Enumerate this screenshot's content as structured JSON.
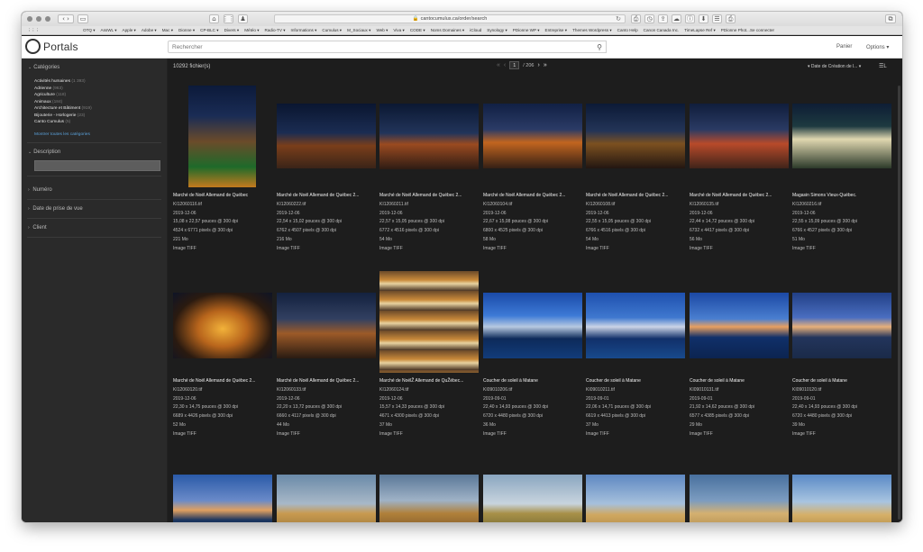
{
  "browser": {
    "url": "cantocumulus.ca/order/search",
    "bookmarks": [
      "OTQ ▾",
      "AssWL ▾",
      "Apple ▾",
      "Adobe ▾",
      "Mac ▾",
      "Dionne ▾",
      "CP-BLC ▾",
      "Divers ▾",
      "Météo ▾",
      "Radio-TV ▾",
      "Informations ▾",
      "Cumulus ▾",
      "M_Sociaux ▾",
      "Web ▾",
      "Viva ▾",
      "CODE ▾",
      "Noms Domaines ▾",
      "iCloud",
      "Synology ▾",
      "PDionne WP ▾",
      "Entreprise ▾",
      "Themes Wordpress ▾",
      "Canto Help",
      "Canon Canada Inc.",
      "TimeLapse Ref ▾",
      "PDionne Phot...Se connecter"
    ]
  },
  "header": {
    "logo_text": "Portals",
    "search_placeholder": "Rechercher",
    "cart_label": "Panier",
    "options_label": "Options ▾"
  },
  "sidebar": {
    "categories_title": "Catégories",
    "categories": [
      {
        "label": "Activités humaines",
        "count": "(1 393)"
      },
      {
        "label": "Adrienne",
        "count": "(963)"
      },
      {
        "label": "Agriculture",
        "count": "(118)"
      },
      {
        "label": "Animaux",
        "count": "(184)"
      },
      {
        "label": "Architecture et Bâtiment",
        "count": "(919)"
      },
      {
        "label": "Bijouterie - Horlogerie",
        "count": "(23)"
      },
      {
        "label": "Canto Cumulus",
        "count": "(5)"
      }
    ],
    "show_all": "Montrer toutes les catégories",
    "description_title": "Description",
    "numero_title": "Numéro",
    "date_title": "Date de prise de vue",
    "client_title": "Client"
  },
  "results": {
    "count_label": "10292 fichier(s)",
    "current_page": "1",
    "total_pages": "/ 206",
    "sort_label": "▾ Date de Création de l... ▾",
    "items": [
      {
        "title": "Marché de Noël Allemand de Québec",
        "file": "KI12060116.tif",
        "date": "2019-12-06",
        "inches": "15,08 x 22,57 pouces @ 300 dpi",
        "pixels": "4524 x 6771 pixels @ 300 dpi",
        "size": "221 Mo",
        "type": "Image TIFF"
      },
      {
        "title": "Marché de Noël Allemand de Québec 2...",
        "file": "KI12060222.tif",
        "date": "2019-12-06",
        "inches": "22,54 x 15,02 pouces @ 300 dpi",
        "pixels": "6762 x 4507 pixels @ 300 dpi",
        "size": "216 Mo",
        "type": "Image TIFF"
      },
      {
        "title": "Marché de Noël Allemand de Québec 2...",
        "file": "KI12060211.tif",
        "date": "2019-12-06",
        "inches": "22,57 x 15,05 pouces @ 300 dpi",
        "pixels": "6772 x 4516 pixels @ 300 dpi",
        "size": "54 Mo",
        "type": "Image TIFF"
      },
      {
        "title": "Marché de Noël Allemand de Québec 2...",
        "file": "KI12060104.tif",
        "date": "2019-12-06",
        "inches": "22,67 x 15,08 pouces @ 300 dpi",
        "pixels": "6800 x 4525 pixels @ 300 dpi",
        "size": "58 Mo",
        "type": "Image TIFF"
      },
      {
        "title": "Marché de Noël Allemand de Québec 2...",
        "file": "KI12060108.tif",
        "date": "2019-12-06",
        "inches": "22,55 x 15,05 pouces @ 300 dpi",
        "pixels": "6766 x 4516 pixels @ 300 dpi",
        "size": "54 Mo",
        "type": "Image TIFF"
      },
      {
        "title": "Marché de Noël Allemand de Québec 2...",
        "file": "KI12060135.tif",
        "date": "2019-12-06",
        "inches": "22,44 x 14,72 pouces @ 300 dpi",
        "pixels": "6732 x 4417 pixels @ 300 dpi",
        "size": "56 Mo",
        "type": "Image TIFF"
      },
      {
        "title": "Magasin Simons Vieux-Québec.",
        "file": "KI12060216.tif",
        "date": "2019-12-06",
        "inches": "22,55 x 15,09 pouces @ 300 dpi",
        "pixels": "6766 x 4527 pixels @ 300 dpi",
        "size": "51 Mo",
        "type": "Image TIFF"
      },
      {
        "title": "Marché de Noël Allemand de Québec 2...",
        "file": "KI12060120.tif",
        "date": "2019-12-06",
        "inches": "22,30 x 14,75 pouces @ 300 dpi",
        "pixels": "6689 x 4426 pixels @ 300 dpi",
        "size": "52 Mo",
        "type": "Image TIFF"
      },
      {
        "title": "Marché de Noël Allemand de Québec 2...",
        "file": "KI12060133.tif",
        "date": "2019-12-06",
        "inches": "22,20 x 13,72 pouces @ 300 dpi",
        "pixels": "6660 x 4117 pixels @ 300 dpi",
        "size": "44 Mo",
        "type": "Image TIFF"
      },
      {
        "title": "Marché de NoëlŽ Allemand de QuŽébec...",
        "file": "KI12060124.tif",
        "date": "2019-12-06",
        "inches": "15,57 x 14,33 pouces @ 300 dpi",
        "pixels": "4671 x 4300 pixels @ 300 dpi",
        "size": "37 Mo",
        "type": "Image TIFF"
      },
      {
        "title": "Coucher de soleil à Matane",
        "file": "KI09010206.tif",
        "date": "2019-09-01",
        "inches": "22,40 x 14,93 pouces @ 300 dpi",
        "pixels": "6720 x 4480 pixels @ 300 dpi",
        "size": "36 Mo",
        "type": "Image TIFF"
      },
      {
        "title": "Coucher de soleil à Matane",
        "file": "KI09010211.tif",
        "date": "2019-09-01",
        "inches": "22,06 x 14,71 pouces @ 300 dpi",
        "pixels": "6619 x 4413 pixels @ 300 dpi",
        "size": "37 Mo",
        "type": "Image TIFF"
      },
      {
        "title": "Coucher de soleil à Matane",
        "file": "KI09010131.tif",
        "date": "2019-09-01",
        "inches": "21,92 x 14,62 pouces @ 300 dpi",
        "pixels": "6577 x 4385 pixels @ 300 dpi",
        "size": "29 Mo",
        "type": "Image TIFF"
      },
      {
        "title": "Coucher de soleil à Matane",
        "file": "KI09010120.tif",
        "date": "2019-09-01",
        "inches": "22,40 x 14,93 pouces @ 300 dpi",
        "pixels": "6720 x 4480 pixels @ 300 dpi",
        "size": "39 Mo",
        "type": "Image TIFF"
      },
      {},
      {},
      {},
      {},
      {},
      {},
      {}
    ]
  }
}
